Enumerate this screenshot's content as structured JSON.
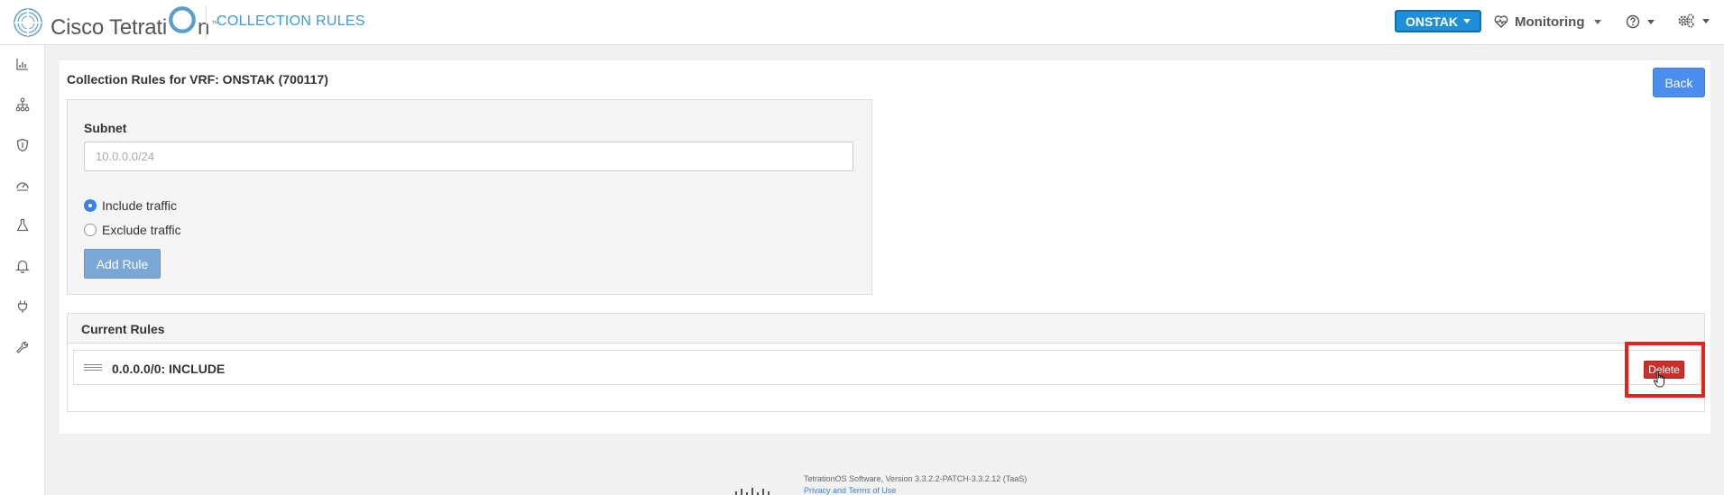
{
  "header": {
    "brand": "Cisco Tetrati",
    "brand_tail": "n",
    "trademark": "™",
    "page_title": "COLLECTION RULES",
    "scope": "ONSTAK",
    "monitoring": "Monitoring"
  },
  "sidebar": {
    "icons": [
      "dashboard-icon",
      "topology-icon",
      "security-icon",
      "speedometer-icon",
      "flask-icon",
      "bell-icon",
      "plug-icon",
      "wrench-icon"
    ]
  },
  "main": {
    "title": "Collection Rules for VRF: ONSTAK (700117)",
    "back_label": "Back",
    "form": {
      "subnet_label": "Subnet",
      "subnet_placeholder": "10.0.0.0/24",
      "subnet_value": "",
      "include_label": "Include traffic",
      "exclude_label": "Exclude traffic",
      "selected": "include",
      "add_rule_label": "Add Rule"
    },
    "current_rules": {
      "header": "Current Rules",
      "rules": [
        {
          "text": "0.0.0.0/0: INCLUDE",
          "delete_label": "Delete"
        }
      ]
    }
  },
  "footer": {
    "version": "TetrationOS Software, Version 3.3.2.2-PATCH-3.3.2.12 (TaaS)",
    "privacy": "Privacy and Terms of Use"
  },
  "colors": {
    "accent": "#3d9ad6",
    "scope_button": "#1e8fd8",
    "back_button": "#4b8ef0",
    "delete_button": "#c9302c",
    "highlight": "#e8211c"
  }
}
